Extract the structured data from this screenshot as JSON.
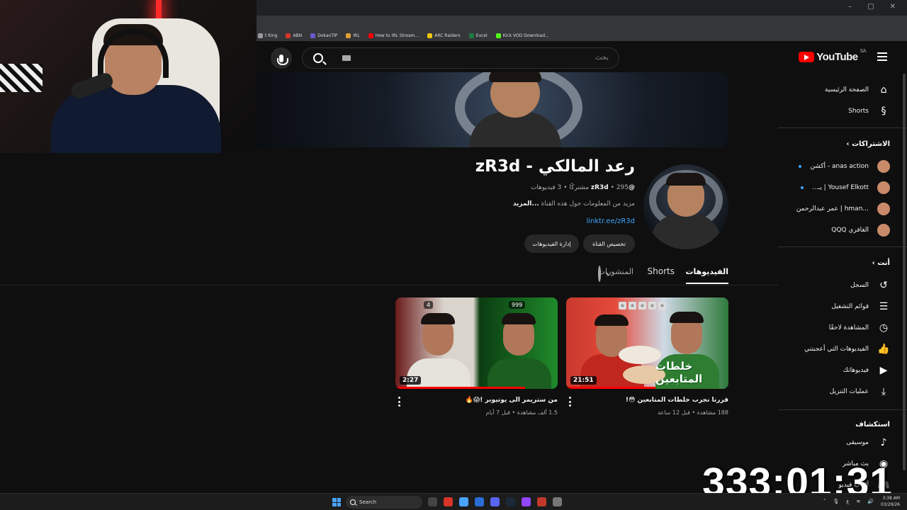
{
  "browser": {
    "bookmarks": [
      {
        "label": "t King",
        "color": "#9a9a9a"
      },
      {
        "label": "ABN",
        "color": "#d8342a"
      },
      {
        "label": "DokanTIP",
        "color": "#6a5acd"
      },
      {
        "label": "IRL",
        "color": "#e0a030"
      },
      {
        "label": "How to IRL Stream...",
        "color": "#ff0000"
      },
      {
        "label": "ARC Raiders",
        "color": "#f1c40f"
      },
      {
        "label": "Excel",
        "color": "#1f7a44"
      },
      {
        "label": "Kick VOD Download...",
        "color": "#53fc18"
      }
    ]
  },
  "header": {
    "logo_text": "YouTube",
    "region": "SA",
    "search_placeholder": "بحث"
  },
  "channel": {
    "title": "رعد المالكي - zR3d",
    "handle": "@zR3d",
    "subscribers": "295 مشتركًا",
    "video_count": "3 فيديوهات",
    "separator": "•",
    "description": "مزيد من المعلومات حول هذه القناة ",
    "more": "...المزيد",
    "link": "linktr.ee/zR3d",
    "customize_button": "تخصيص القناة",
    "manage_button": "إدارة الفيديوهات"
  },
  "tabs": {
    "videos": "الفيديوهات",
    "shorts": "Shorts",
    "posts": "المنشورات"
  },
  "videos": [
    {
      "title": "قررنا نجرب خلطات المتابعين 😳!",
      "meta": "188 مشاهدة • قبل 12 ساعة",
      "duration": "21:51",
      "overlay_text": "خلطات المتابعين",
      "progress": 0.55
    },
    {
      "title": "من ستريمر الى يوتيوبر !😱🔥",
      "meta": "1.5 ألف مشاهدة • قبل 7 أيام",
      "duration": "2:27",
      "counter_left": "4",
      "counter_right": "999",
      "progress": 0.8
    }
  ],
  "sidebar": {
    "home": "الصفحة الرئيسية",
    "shorts": "Shorts",
    "subscriptions_header": "الاشتراكات",
    "subscriptions": [
      {
        "name": "anas action - أكشن"
      },
      {
        "name": "Yousef Elkott | يـ..."
      },
      {
        "name": "...hman | عمر عبدالرحمن"
      },
      {
        "name": "الغافري QQQ"
      }
    ],
    "you_header": "أنت",
    "you_items": [
      {
        "label": "السجل",
        "icon": "history-icon",
        "glyph": "↺"
      },
      {
        "label": "قوائم التشغيل",
        "icon": "playlist-icon",
        "glyph": "☰"
      },
      {
        "label": "المشاهدة لاحقًا",
        "icon": "watch-later-icon",
        "glyph": "◷"
      },
      {
        "label": "الفيديوهات التي أعجبتني",
        "icon": "like-icon",
        "glyph": "👍"
      },
      {
        "label": "فيديوهاتك",
        "icon": "your-videos-icon",
        "glyph": "▶"
      },
      {
        "label": "عمليات التنزيل",
        "icon": "download-icon",
        "glyph": "⤓"
      }
    ],
    "explore_header": "استكشاف",
    "explore_items": [
      {
        "label": "موسيقى",
        "icon": "music-icon",
        "glyph": "♪"
      },
      {
        "label": "بث مباشر",
        "icon": "live-icon",
        "glyph": "◉"
      },
      {
        "label": "ألعاب فيديو",
        "icon": "gaming-icon",
        "glyph": "🎮"
      }
    ]
  },
  "overlay": {
    "timer": "333:01:31"
  },
  "taskbar": {
    "search_label": "Search",
    "time": "3:38 AM",
    "date": "03/29/26",
    "lang": "ع",
    "apps": [
      "#444",
      "#d8342a",
      "#4aa3ff",
      "#2a6bd6",
      "#5865f2",
      "#1b2838",
      "#9146ff",
      "#c0392b",
      "#777"
    ]
  }
}
